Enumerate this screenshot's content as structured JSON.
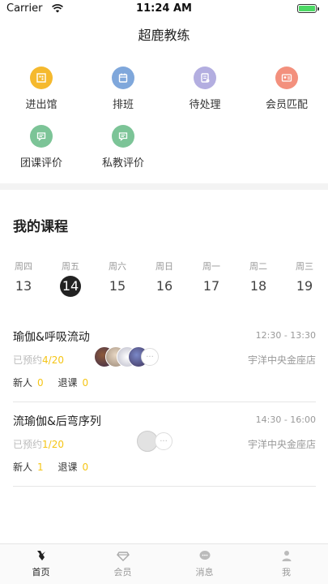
{
  "status_bar": {
    "carrier": "Carrier",
    "time": "11:24 AM"
  },
  "header": {
    "title": "超鹿教练"
  },
  "quick_actions": [
    {
      "label": "进出馆",
      "icon": "qr-code-icon",
      "color": "#f5b92e"
    },
    {
      "label": "排班",
      "icon": "calendar-icon",
      "color": "#7fa7db"
    },
    {
      "label": "待处理",
      "icon": "document-icon",
      "color": "#b3aee0"
    },
    {
      "label": "会员匹配",
      "icon": "member-card-icon",
      "color": "#f3907d"
    },
    {
      "label": "团课评价",
      "icon": "comment-icon",
      "color": "#7cc497"
    },
    {
      "label": "私教评价",
      "icon": "comment-icon",
      "color": "#7cc497"
    }
  ],
  "my_courses": {
    "title": "我的课程",
    "week": [
      {
        "day": "周四",
        "date": "13"
      },
      {
        "day": "周五",
        "date": "14",
        "selected": true
      },
      {
        "day": "周六",
        "date": "15"
      },
      {
        "day": "周日",
        "date": "16"
      },
      {
        "day": "周一",
        "date": "17"
      },
      {
        "day": "周二",
        "date": "18"
      },
      {
        "day": "周三",
        "date": "19"
      }
    ],
    "courses": [
      {
        "name": "瑜伽&呼吸流动",
        "time": "12:30 - 13:30",
        "booked_label": "已预约",
        "booked_count": "4/20",
        "location": "宇洋中央金座店",
        "new_label": "新人",
        "new_count": "0",
        "cancel_label": "退课",
        "cancel_count": "0"
      },
      {
        "name": "流瑜伽&后弯序列",
        "time": "14:30 - 16:00",
        "booked_label": "已预约",
        "booked_count": "1/20",
        "location": "宇洋中央金座店",
        "new_label": "新人",
        "new_count": "1",
        "cancel_label": "退课",
        "cancel_count": "0"
      }
    ]
  },
  "tab_bar": [
    {
      "label": "首页",
      "icon": "deer-home-icon",
      "active": true
    },
    {
      "label": "会员",
      "icon": "diamond-icon"
    },
    {
      "label": "消息",
      "icon": "chat-bubble-icon"
    },
    {
      "label": "我",
      "icon": "person-icon"
    }
  ],
  "colors": {
    "accent": "#f5c516",
    "text": "#222222",
    "muted": "#999999"
  }
}
